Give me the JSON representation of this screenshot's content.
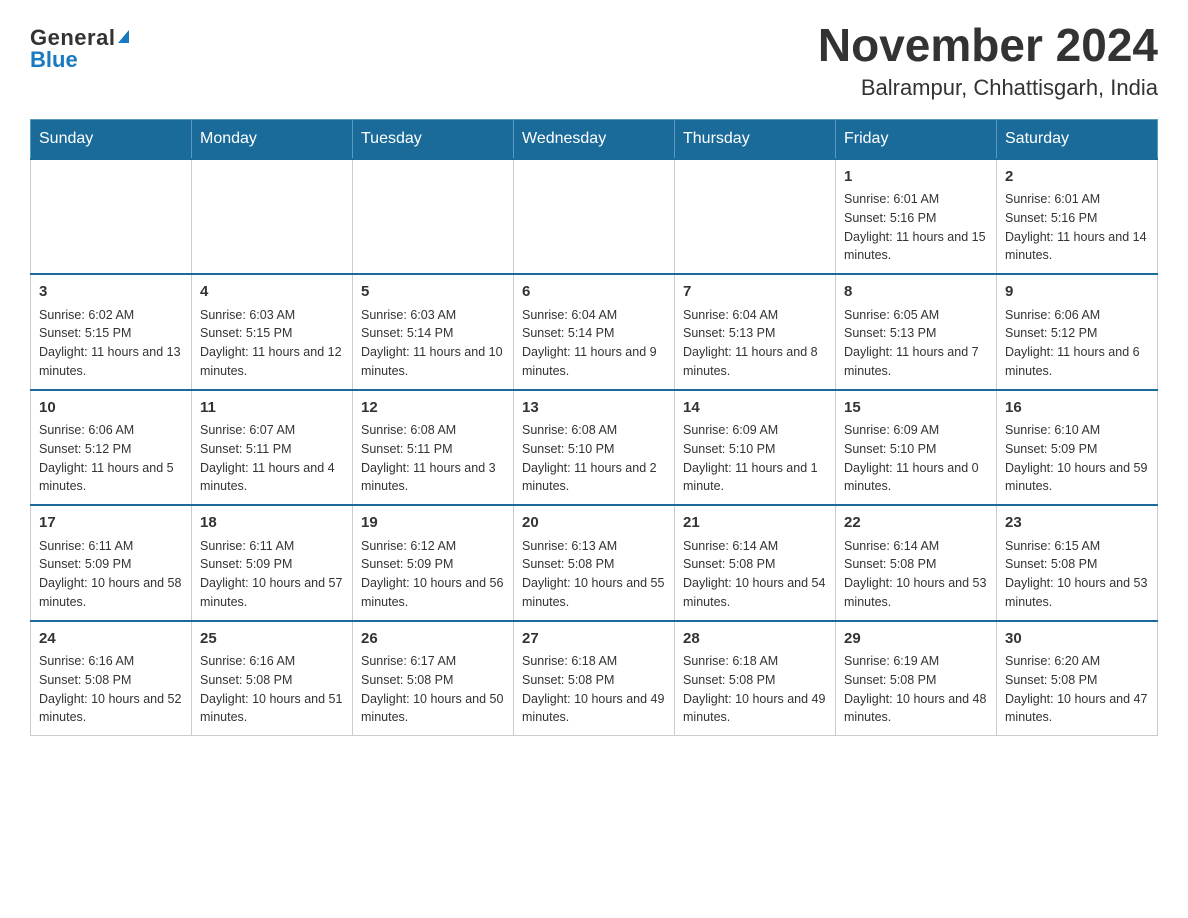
{
  "logo": {
    "general": "General",
    "blue": "Blue",
    "triangle": "▲"
  },
  "title": "November 2024",
  "subtitle": "Balrampur, Chhattisgarh, India",
  "weekdays": [
    "Sunday",
    "Monday",
    "Tuesday",
    "Wednesday",
    "Thursday",
    "Friday",
    "Saturday"
  ],
  "weeks": [
    [
      {
        "day": "",
        "info": ""
      },
      {
        "day": "",
        "info": ""
      },
      {
        "day": "",
        "info": ""
      },
      {
        "day": "",
        "info": ""
      },
      {
        "day": "",
        "info": ""
      },
      {
        "day": "1",
        "info": "Sunrise: 6:01 AM\nSunset: 5:16 PM\nDaylight: 11 hours and 15 minutes."
      },
      {
        "day": "2",
        "info": "Sunrise: 6:01 AM\nSunset: 5:16 PM\nDaylight: 11 hours and 14 minutes."
      }
    ],
    [
      {
        "day": "3",
        "info": "Sunrise: 6:02 AM\nSunset: 5:15 PM\nDaylight: 11 hours and 13 minutes."
      },
      {
        "day": "4",
        "info": "Sunrise: 6:03 AM\nSunset: 5:15 PM\nDaylight: 11 hours and 12 minutes."
      },
      {
        "day": "5",
        "info": "Sunrise: 6:03 AM\nSunset: 5:14 PM\nDaylight: 11 hours and 10 minutes."
      },
      {
        "day": "6",
        "info": "Sunrise: 6:04 AM\nSunset: 5:14 PM\nDaylight: 11 hours and 9 minutes."
      },
      {
        "day": "7",
        "info": "Sunrise: 6:04 AM\nSunset: 5:13 PM\nDaylight: 11 hours and 8 minutes."
      },
      {
        "day": "8",
        "info": "Sunrise: 6:05 AM\nSunset: 5:13 PM\nDaylight: 11 hours and 7 minutes."
      },
      {
        "day": "9",
        "info": "Sunrise: 6:06 AM\nSunset: 5:12 PM\nDaylight: 11 hours and 6 minutes."
      }
    ],
    [
      {
        "day": "10",
        "info": "Sunrise: 6:06 AM\nSunset: 5:12 PM\nDaylight: 11 hours and 5 minutes."
      },
      {
        "day": "11",
        "info": "Sunrise: 6:07 AM\nSunset: 5:11 PM\nDaylight: 11 hours and 4 minutes."
      },
      {
        "day": "12",
        "info": "Sunrise: 6:08 AM\nSunset: 5:11 PM\nDaylight: 11 hours and 3 minutes."
      },
      {
        "day": "13",
        "info": "Sunrise: 6:08 AM\nSunset: 5:10 PM\nDaylight: 11 hours and 2 minutes."
      },
      {
        "day": "14",
        "info": "Sunrise: 6:09 AM\nSunset: 5:10 PM\nDaylight: 11 hours and 1 minute."
      },
      {
        "day": "15",
        "info": "Sunrise: 6:09 AM\nSunset: 5:10 PM\nDaylight: 11 hours and 0 minutes."
      },
      {
        "day": "16",
        "info": "Sunrise: 6:10 AM\nSunset: 5:09 PM\nDaylight: 10 hours and 59 minutes."
      }
    ],
    [
      {
        "day": "17",
        "info": "Sunrise: 6:11 AM\nSunset: 5:09 PM\nDaylight: 10 hours and 58 minutes."
      },
      {
        "day": "18",
        "info": "Sunrise: 6:11 AM\nSunset: 5:09 PM\nDaylight: 10 hours and 57 minutes."
      },
      {
        "day": "19",
        "info": "Sunrise: 6:12 AM\nSunset: 5:09 PM\nDaylight: 10 hours and 56 minutes."
      },
      {
        "day": "20",
        "info": "Sunrise: 6:13 AM\nSunset: 5:08 PM\nDaylight: 10 hours and 55 minutes."
      },
      {
        "day": "21",
        "info": "Sunrise: 6:14 AM\nSunset: 5:08 PM\nDaylight: 10 hours and 54 minutes."
      },
      {
        "day": "22",
        "info": "Sunrise: 6:14 AM\nSunset: 5:08 PM\nDaylight: 10 hours and 53 minutes."
      },
      {
        "day": "23",
        "info": "Sunrise: 6:15 AM\nSunset: 5:08 PM\nDaylight: 10 hours and 53 minutes."
      }
    ],
    [
      {
        "day": "24",
        "info": "Sunrise: 6:16 AM\nSunset: 5:08 PM\nDaylight: 10 hours and 52 minutes."
      },
      {
        "day": "25",
        "info": "Sunrise: 6:16 AM\nSunset: 5:08 PM\nDaylight: 10 hours and 51 minutes."
      },
      {
        "day": "26",
        "info": "Sunrise: 6:17 AM\nSunset: 5:08 PM\nDaylight: 10 hours and 50 minutes."
      },
      {
        "day": "27",
        "info": "Sunrise: 6:18 AM\nSunset: 5:08 PM\nDaylight: 10 hours and 49 minutes."
      },
      {
        "day": "28",
        "info": "Sunrise: 6:18 AM\nSunset: 5:08 PM\nDaylight: 10 hours and 49 minutes."
      },
      {
        "day": "29",
        "info": "Sunrise: 6:19 AM\nSunset: 5:08 PM\nDaylight: 10 hours and 48 minutes."
      },
      {
        "day": "30",
        "info": "Sunrise: 6:20 AM\nSunset: 5:08 PM\nDaylight: 10 hours and 47 minutes."
      }
    ]
  ]
}
